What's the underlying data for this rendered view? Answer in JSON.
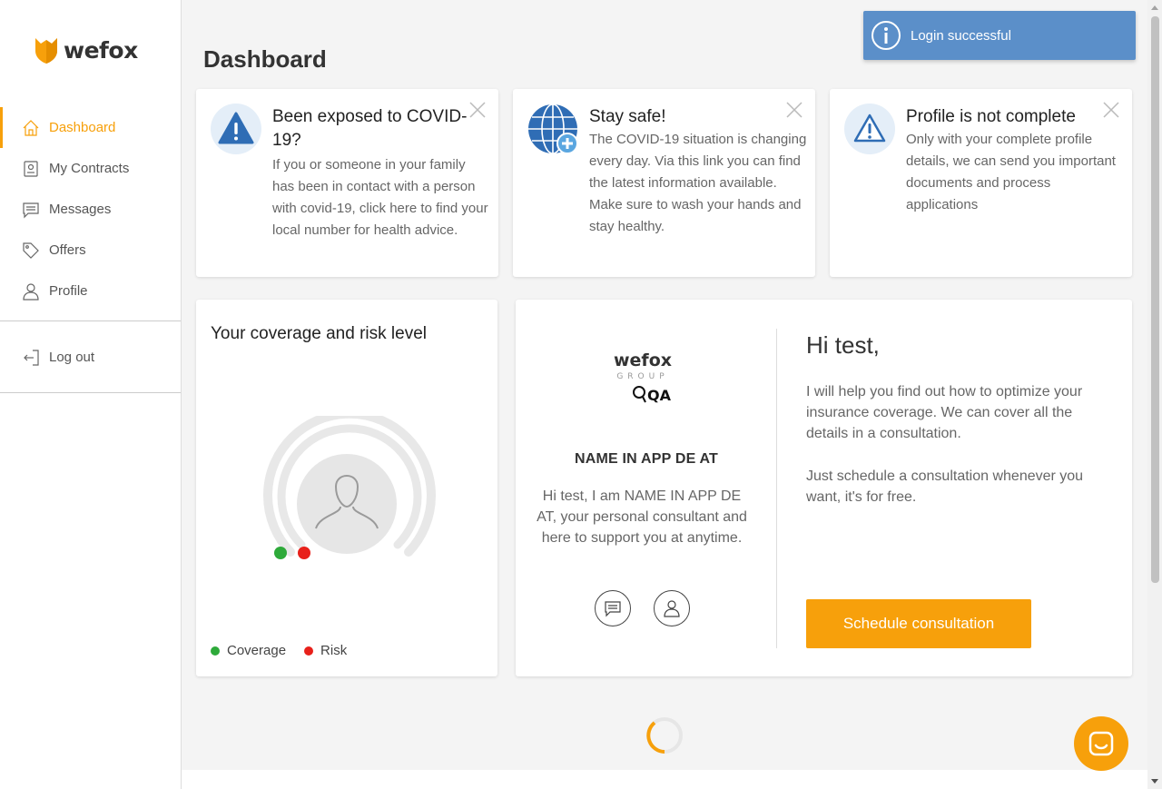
{
  "brand": {
    "name": "wefox",
    "accent": "#f7a00b",
    "info_blue": "#5b8fc9"
  },
  "sidebar": {
    "items": [
      {
        "label": "Dashboard",
        "icon": "home-icon",
        "active": true
      },
      {
        "label": "My Contracts",
        "icon": "contract-icon",
        "active": false
      },
      {
        "label": "Messages",
        "icon": "message-icon",
        "active": false
      },
      {
        "label": "Offers",
        "icon": "tag-icon",
        "active": false
      },
      {
        "label": "Profile",
        "icon": "user-icon",
        "active": false
      }
    ],
    "logout_label": "Log out"
  },
  "page": {
    "title": "Dashboard"
  },
  "alerts": [
    {
      "title": "Been exposed to COVID-19?",
      "body": "If you or someone in your family has been in contact with a person with covid-19, click here to find your local number for health advice.",
      "icon": "warning-icon"
    },
    {
      "title": "Stay safe!",
      "body": "The COVID-19 situation is changing every day. Via this link you can find the latest information available. Make sure to wash your hands and stay healthy.",
      "icon": "globe-plus-icon"
    },
    {
      "title": "Profile is not complete",
      "body": "Only with your complete profile details, we can send you important documents and process applications",
      "icon": "warning-outline-icon"
    }
  ],
  "coverage": {
    "title": "Your coverage and risk level",
    "legend": {
      "coverage": "Coverage",
      "risk": "Risk"
    },
    "colors": {
      "coverage": "#2eaa3a",
      "risk": "#e8201a"
    }
  },
  "consultant": {
    "logo_text": "wefox",
    "logo_sub": "GROUP",
    "logo_tag": "QA",
    "name": "NAME IN APP DE AT",
    "intro": "Hi test, I am NAME IN APP DE AT, your personal consultant and here to support you at anytime.",
    "greeting": "Hi test,",
    "pitch_1": "I will help you find out how to optimize your insurance coverage. We can cover all the details in a consultation.",
    "pitch_2": "Just schedule a consultation whenever you want, it's for free.",
    "cta": "Schedule consultation"
  },
  "toast": {
    "message": "Login successful",
    "icon": "info-icon"
  }
}
